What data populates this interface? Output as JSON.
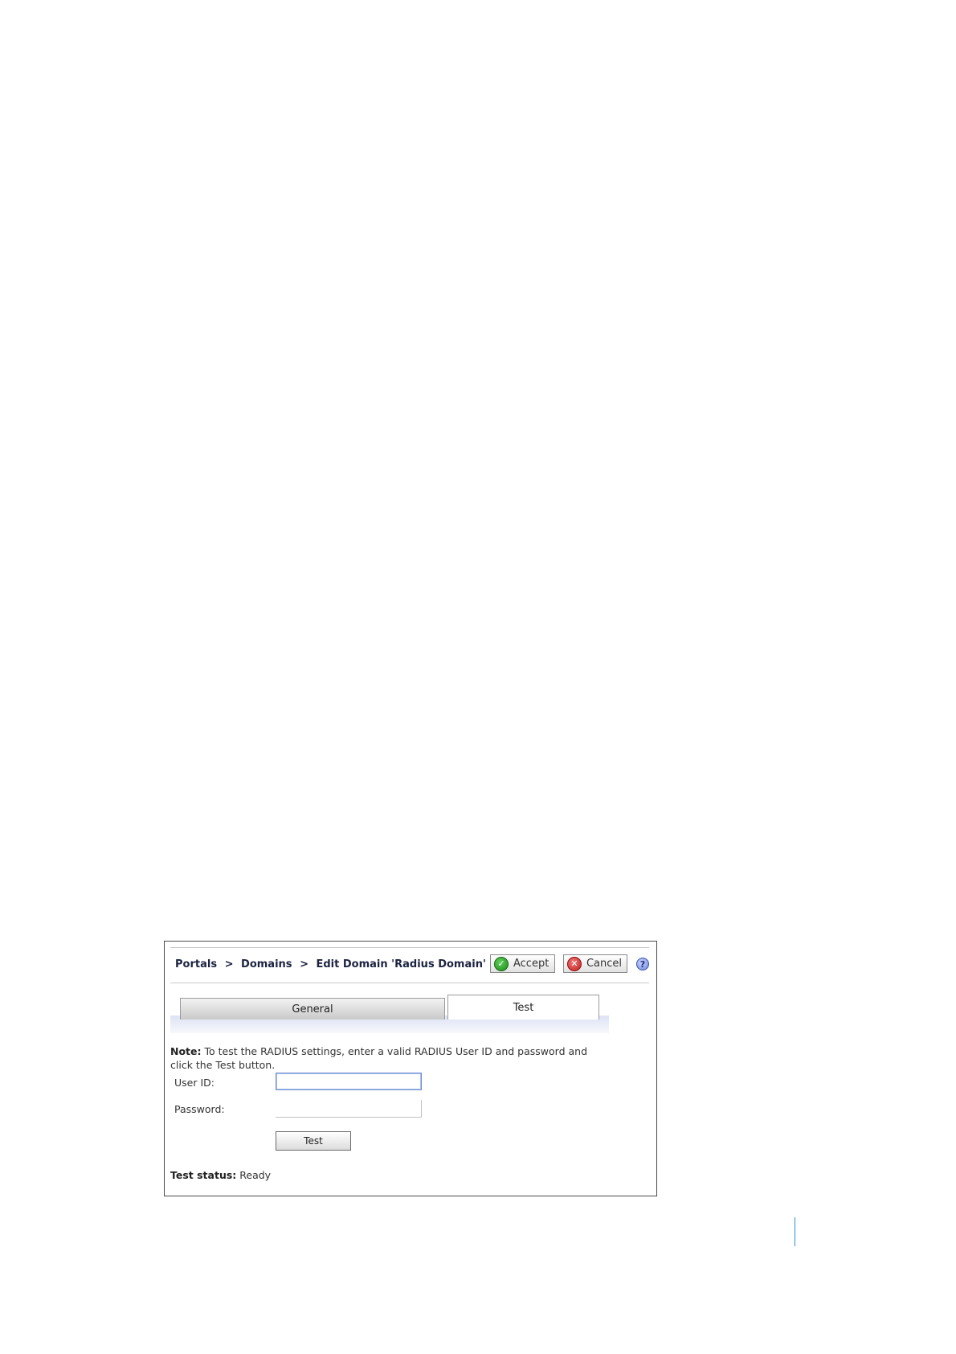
{
  "header": {
    "breadcrumb": {
      "item1": "Portals",
      "item2": "Domains",
      "item3": "Edit Domain 'Radius Domain'",
      "separator": ">"
    },
    "accept_label": "Accept",
    "cancel_label": "Cancel",
    "help_glyph": "?"
  },
  "tabs": [
    {
      "label": "General",
      "active": false
    },
    {
      "label": "Test",
      "active": true
    }
  ],
  "note": {
    "label": "Note:",
    "text": " To test the RADIUS settings, enter a valid RADIUS User ID and password and click the Test button."
  },
  "form": {
    "userid_label": "User ID:",
    "userid_value": "",
    "password_label": "Password:",
    "password_value": "",
    "test_button_label": "Test"
  },
  "status": {
    "label": "Test status:",
    "value": " Ready"
  },
  "icons": {
    "accept": "check-circle-icon",
    "cancel": "x-circle-icon",
    "help": "help-icon"
  },
  "colors": {
    "accept_icon": "#1f8a1c",
    "cancel_icon": "#c21d1d",
    "help_icon": "#6f86d8",
    "page_marker": "#2b8fd6",
    "breadcrumb_text": "#1c2340"
  }
}
